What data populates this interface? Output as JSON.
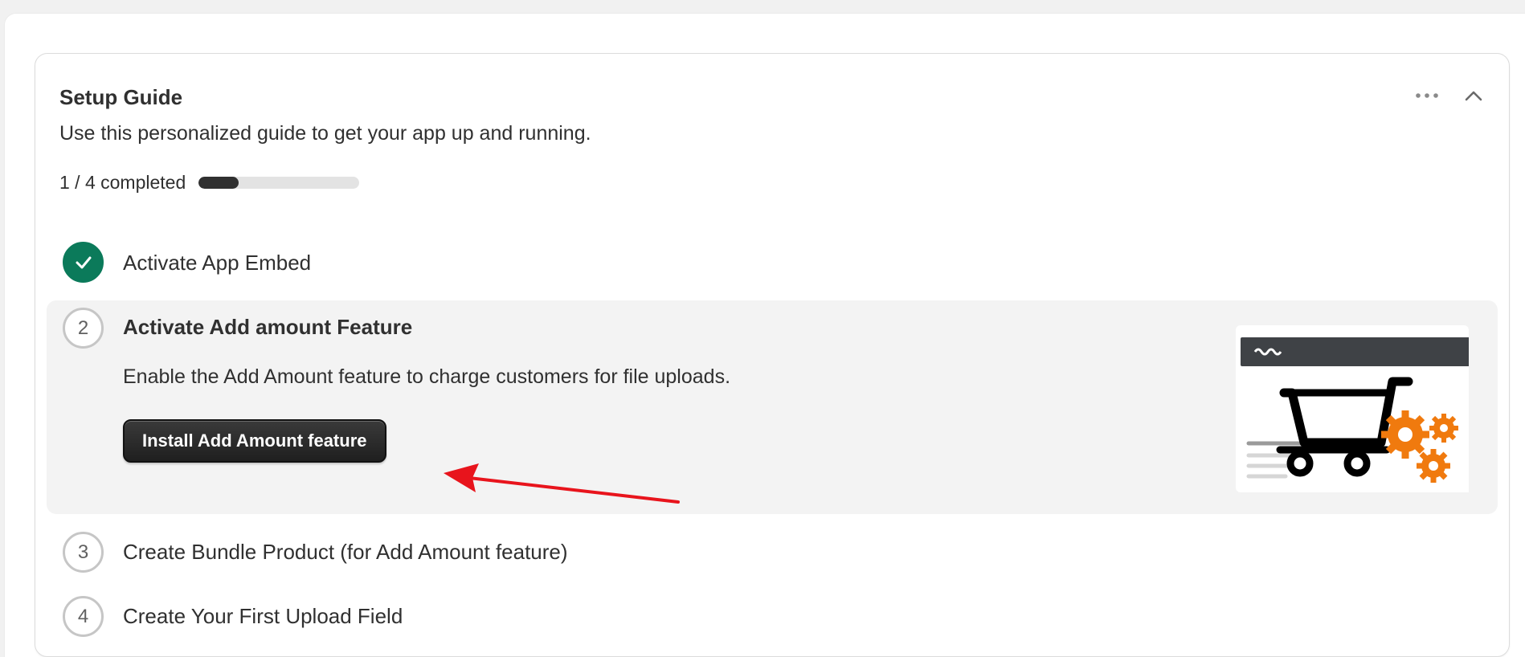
{
  "guide": {
    "title": "Setup Guide",
    "subtitle": "Use this personalized guide to get your app up and running.",
    "progress_label": "1 / 4 completed",
    "progress_fraction": 0.25,
    "menu_icon": "more-horizontal-icon",
    "collapse_icon": "chevron-up-icon"
  },
  "steps": [
    {
      "number": "1",
      "label": "Activate App Embed",
      "completed": true
    },
    {
      "number": "2",
      "label": "Activate Add amount Feature",
      "description": "Enable the Add Amount feature to charge customers for file uploads.",
      "button_label": "Install Add Amount feature",
      "completed": false,
      "expanded": true,
      "illustration": "shopping-cart-gears-illustration"
    },
    {
      "number": "3",
      "label": "Create Bundle Product (for Add Amount feature)",
      "completed": false
    },
    {
      "number": "4",
      "label": "Create Your First Upload Field",
      "completed": false
    }
  ],
  "colors": {
    "completed_green": "#0b7a5a",
    "button_dark": "#303030",
    "annotation_arrow": "#e8141c",
    "gear_orange": "#f07a0e"
  }
}
